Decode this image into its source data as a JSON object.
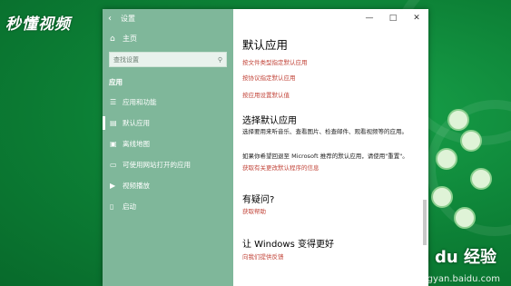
{
  "watermark": {
    "top": "秒懂视频",
    "bottom": "Bai du 经验",
    "sub": "jingyan.baidu.com"
  },
  "window": {
    "title": "设置",
    "controls": {
      "minimize": "—",
      "maximize": "□",
      "close": "✕"
    }
  },
  "sidebar": {
    "home": "主页",
    "search_placeholder": "查找设置",
    "section": "应用",
    "items": [
      {
        "label": "应用和功能",
        "icon": "apps-list-icon"
      },
      {
        "label": "默认应用",
        "icon": "default-apps-icon",
        "active": true
      },
      {
        "label": "离线地图",
        "icon": "map-icon"
      },
      {
        "label": "可使用网站打开的应用",
        "icon": "web-link-icon"
      },
      {
        "label": "视频播放",
        "icon": "video-icon"
      },
      {
        "label": "启动",
        "icon": "startup-icon"
      }
    ]
  },
  "content": {
    "title": "默认应用",
    "links_top": [
      "按文件类型指定默认应用",
      "按协议指定默认应用",
      "按应用设置默认值"
    ],
    "section1_title": "选择默认应用",
    "section1_text": "选择要用来听音乐、查看图片、检查邮件、观看视频等的应用。",
    "section1_text2": "如果你希望回退至 Microsoft 推荐的默认应用，请使用\"重置\"。",
    "section1_link": "获取有关更改默认程序的信息",
    "section2_title": "有疑问?",
    "section2_link": "获取帮助",
    "section3_title": "让 Windows 变得更好",
    "section3_link": "向我们提供反馈"
  }
}
